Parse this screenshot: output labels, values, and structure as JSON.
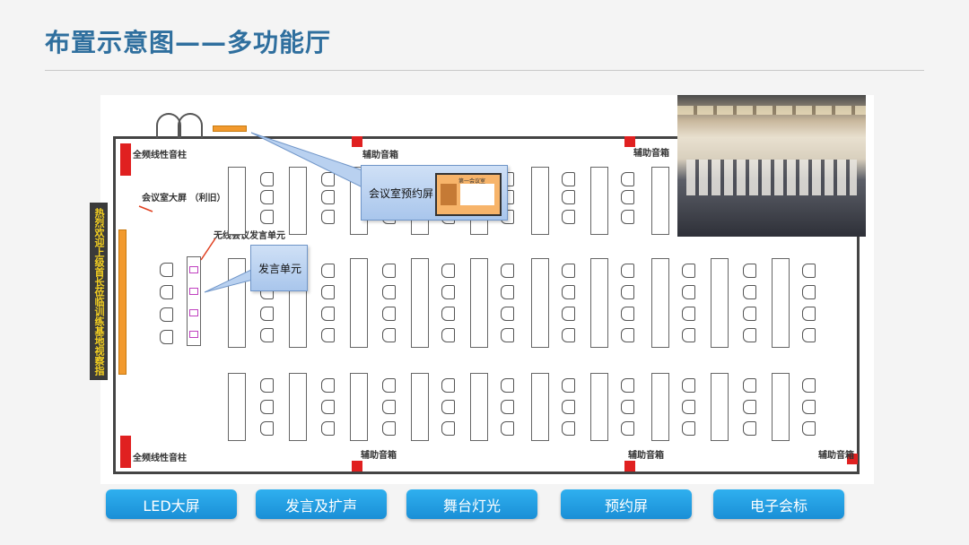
{
  "page": {
    "title": "布置示意图——多功能厅"
  },
  "plan": {
    "labels": {
      "full_freq_top": "全频线性音柱",
      "full_freq_bottom": "全频线性音柱",
      "aux_1": "辅助音箱",
      "aux_2": "辅助音箱",
      "aux_3": "辅助音箱",
      "aux_4": "辅助音箱",
      "aux_5": "辅助音箱",
      "big_screen": "会议室大屏 （利旧）",
      "wireless_unit": "无线会议发言单元",
      "banner": "热烈欢迎上级首长莅临训练基地视察指导！"
    },
    "callouts": {
      "booking_screen": "会议室预约屏",
      "speaker_unit": "发言单元",
      "mini_screen_title": "第一会议室"
    }
  },
  "buttons": [
    "LED大屏",
    "发言及扩声",
    "舞台灯光",
    "预约屏",
    "电子会标"
  ],
  "colors": {
    "title": "#2f6f9e",
    "button": "#1a8fd6",
    "led": "#f29a2e",
    "speaker": "#e02020"
  }
}
